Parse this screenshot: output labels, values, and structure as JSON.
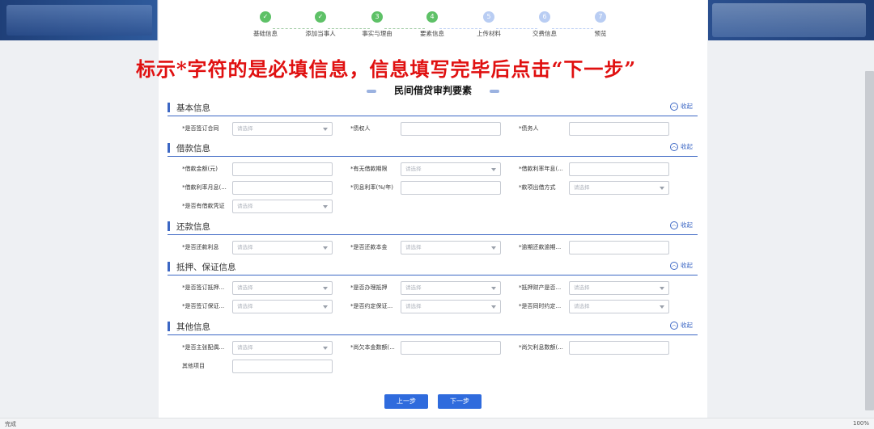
{
  "steps": [
    {
      "label": "基础信息",
      "mark": "✓",
      "state": "done"
    },
    {
      "label": "添加当事人",
      "mark": "✓",
      "state": "done"
    },
    {
      "label": "事实与理由",
      "mark": "3",
      "state": "done"
    },
    {
      "label": "要素信息",
      "mark": "4",
      "state": "done"
    },
    {
      "label": "上传材料",
      "mark": "5",
      "state": "todo"
    },
    {
      "label": "交费信息",
      "mark": "6",
      "state": "todo"
    },
    {
      "label": "预览",
      "mark": "7",
      "state": "todo"
    }
  ],
  "notice": "标示*字符的是必填信息，信息填写完毕后点击“下一步”",
  "form_title": "民间借贷审判要素",
  "collapse_label": "收起",
  "select_placeholder": "请选择",
  "sections": [
    {
      "title": "基本信息",
      "fields": [
        {
          "label": "*是否签订合同",
          "type": "select"
        },
        {
          "label": "*债权人",
          "type": "input"
        },
        {
          "label": "*债务人",
          "type": "input"
        }
      ]
    },
    {
      "title": "借款信息",
      "fields": [
        {
          "label": "*借款金额(元)",
          "type": "input"
        },
        {
          "label": "*有无借款期限",
          "type": "select"
        },
        {
          "label": "*借款利率年息(...",
          "type": "input"
        },
        {
          "label": "*借款利率月息(...",
          "type": "input"
        },
        {
          "label": "*罚息利率(%/年)",
          "type": "input"
        },
        {
          "label": "*款项出借方式",
          "type": "select"
        },
        {
          "label": "*是否有借款凭证",
          "type": "select"
        }
      ]
    },
    {
      "title": "还款信息",
      "fields": [
        {
          "label": "*是否还款利息",
          "type": "select"
        },
        {
          "label": "*是否还款本金",
          "type": "select"
        },
        {
          "label": "*逾期还款逾期...",
          "type": "input"
        }
      ]
    },
    {
      "title": "抵押、保证信息",
      "fields": [
        {
          "label": "*是否签订抵押...",
          "type": "select"
        },
        {
          "label": "*是否办理抵押",
          "type": "select"
        },
        {
          "label": "*抵押财产是否...",
          "type": "select"
        },
        {
          "label": "*是否签订保证...",
          "type": "select"
        },
        {
          "label": "*是否约定保证...",
          "type": "select"
        },
        {
          "label": "*是否同时约定...",
          "type": "select"
        }
      ]
    },
    {
      "title": "其他信息",
      "fields": [
        {
          "label": "*是否主张配偶...",
          "type": "select"
        },
        {
          "label": "*尚欠本金数额(...",
          "type": "input"
        },
        {
          "label": "*尚欠利息数额(...",
          "type": "input"
        },
        {
          "label": "其他项目",
          "type": "input"
        }
      ]
    }
  ],
  "buttons": {
    "prev": "上一步",
    "next": "下一步"
  },
  "status": {
    "left": "完成",
    "zoom": "100%"
  }
}
